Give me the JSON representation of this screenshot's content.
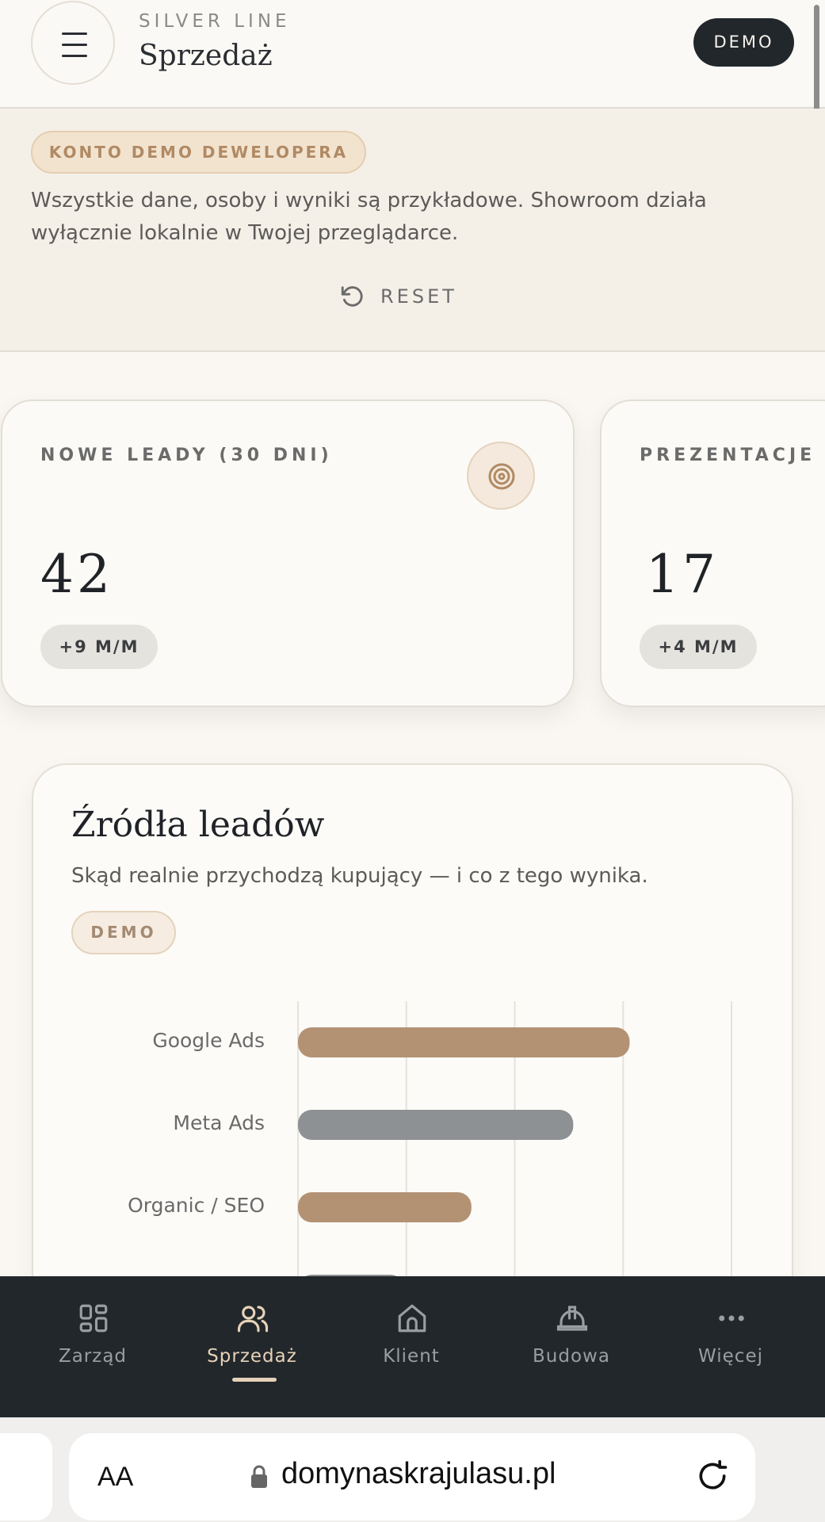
{
  "header": {
    "brand": "SILVER LINE",
    "title": "Sprzedaż",
    "demo_label": "DEMO",
    "menu_icon": "hamburger-icon"
  },
  "notice": {
    "badge": "KONTO DEMO DEWELOPERA",
    "text": "Wszystkie dane, osoby i wyniki są przykładowe. Showroom działa wyłącznie lokalnie w Twojej przeglądarce.",
    "reset_label": "RESET",
    "reset_icon": "rotate-ccw-icon"
  },
  "stats": [
    {
      "label": "NOWE LEADY (30 DNI)",
      "value": "42",
      "delta": "+9 M/M",
      "icon": "target-icon"
    },
    {
      "label": "PREZENTACJE",
      "value": "17",
      "delta": "+4 M/M"
    }
  ],
  "lead_sources": {
    "title": "Źródła leadów",
    "subtitle": "Skąd realnie przychodzą kupujący — i co z tego wynika.",
    "badge": "DEMO"
  },
  "chart_data": {
    "type": "bar",
    "orientation": "horizontal",
    "categories": [
      "Google Ads",
      "Meta Ads",
      "Organic / SEO"
    ],
    "values": [
      15.3,
      12.7,
      8
    ],
    "colors": [
      "#b39274",
      "#8e9194",
      "#b39274"
    ],
    "xlim": [
      0,
      20
    ],
    "grid": true,
    "title": "",
    "xlabel": "",
    "ylabel": ""
  },
  "nav": {
    "items": [
      {
        "label": "Zarząd",
        "icon": "dashboard-grid-icon"
      },
      {
        "label": "Sprzedaż",
        "icon": "users-icon",
        "active": true
      },
      {
        "label": "Klient",
        "icon": "home-icon"
      },
      {
        "label": "Budowa",
        "icon": "hard-hat-icon"
      },
      {
        "label": "Więcej",
        "icon": "more-dots-icon"
      }
    ]
  },
  "browser": {
    "text_size": "AA",
    "url": "domynaskrajulasu.pl",
    "lock_icon": "lock-icon",
    "reload_icon": "reload-icon"
  },
  "colors": {
    "accent": "#b39274",
    "dark": "#22272b",
    "background": "#faf7f2"
  }
}
